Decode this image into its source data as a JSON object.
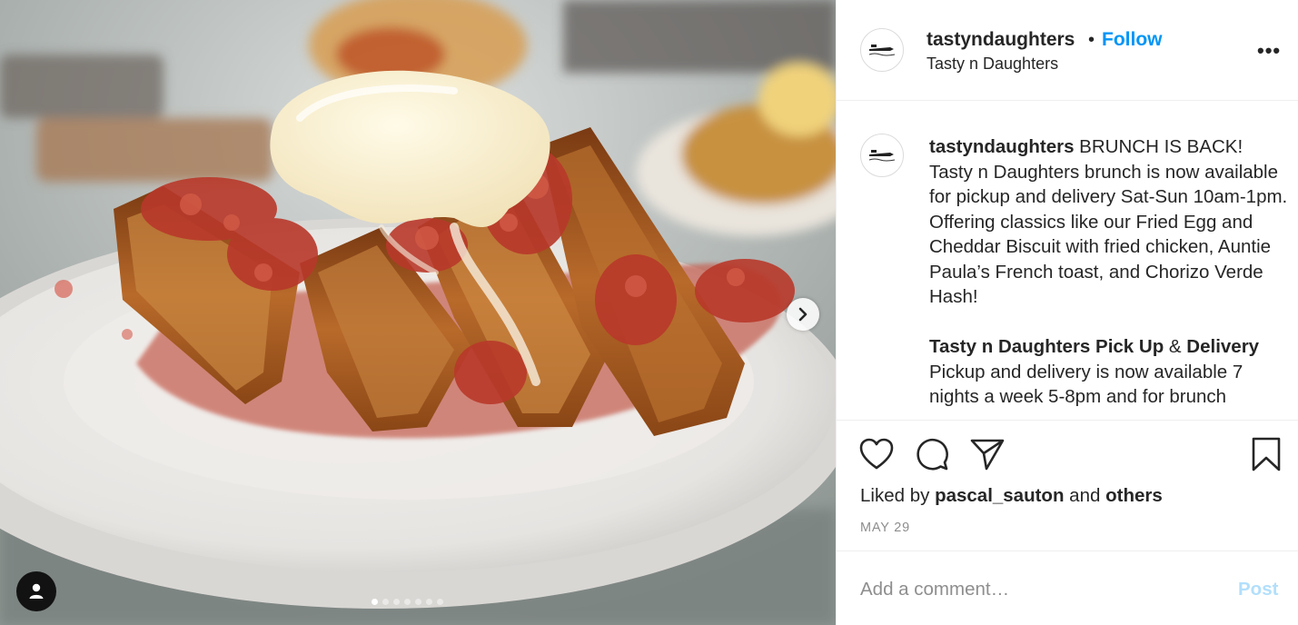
{
  "post": {
    "username": "tastyndaughters",
    "separator": "•",
    "follow_label": "Follow",
    "full_name": "Tasty n Daughters",
    "more_label": "•••",
    "caption": {
      "username": "tastyndaughters",
      "text": " BRUNCH IS BACK! Tasty n Daughters brunch is now available for pickup and delivery Sat-Sun 10am-1pm. Offering classics like our Fried Egg and Cheddar Biscuit with fried chicken, Auntie Paula’s French toast, and Chorizo Verde Hash!",
      "section_title_a": "Tasty n Daughters Pick Up",
      "section_amp": " & ",
      "section_title_b": "Delivery",
      "section_text": "Pickup and delivery is now available 7 nights a week 5-8pm and for brunch"
    },
    "likes": {
      "prefix": "Liked by ",
      "user": "pascal_sauton",
      "middle": " and ",
      "others": "others"
    },
    "date": "MAY 29",
    "comment": {
      "placeholder": "Add a comment…",
      "post_label": "Post"
    },
    "carousel": {
      "slide_count": 7,
      "active_index": 0
    },
    "icons": {
      "like": "heart-icon",
      "comment": "comment-icon",
      "share": "paper-plane-icon",
      "save": "bookmark-icon",
      "next": "chevron-right-icon",
      "tag": "user-tag-icon"
    },
    "colors": {
      "link": "#0095f6",
      "post_disabled": "#b2dffc",
      "muted": "#8e8e8e",
      "text": "#262626"
    }
  }
}
